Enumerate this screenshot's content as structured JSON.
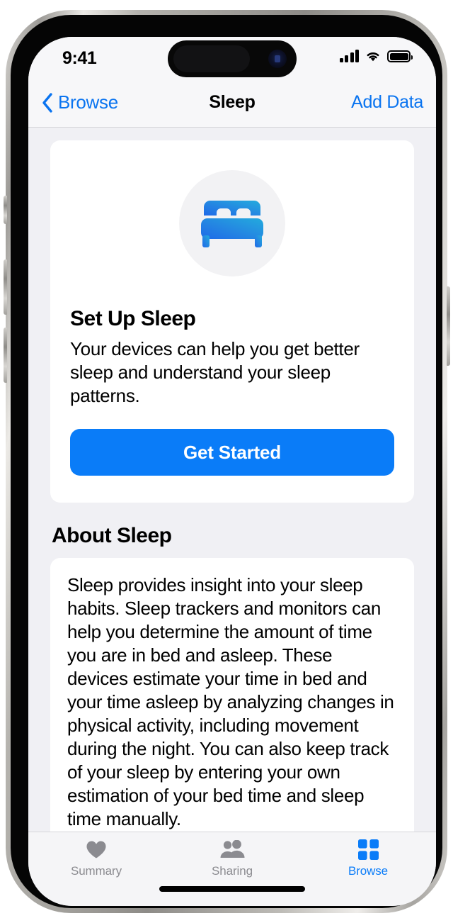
{
  "status_bar": {
    "time": "9:41",
    "cellular_icon": "cellular-signal-icon",
    "wifi_icon": "wifi-icon",
    "battery_icon": "battery-full-icon"
  },
  "nav_bar": {
    "back_icon": "chevron-left-icon",
    "back_label": "Browse",
    "title": "Sleep",
    "action_label": "Add Data"
  },
  "setup_card": {
    "icon": "bed-icon",
    "heading": "Set Up Sleep",
    "description": "Your devices can help you get better sleep and understand your sleep patterns.",
    "button_label": "Get Started"
  },
  "about_section": {
    "heading": "About Sleep",
    "body": "Sleep provides insight into your sleep habits. Sleep trackers and monitors can help you determine the amount of time you are in bed and asleep. These devices estimate your time in bed and your time asleep by analyzing changes in physical activity, including movement during the night. You can also keep track of your sleep by entering your own estimation of your bed time and sleep time manually."
  },
  "tab_bar": {
    "tabs": [
      {
        "label": "Summary",
        "icon": "heart-icon",
        "active": false
      },
      {
        "label": "Sharing",
        "icon": "people-icon",
        "active": false
      },
      {
        "label": "Browse",
        "icon": "grid-squares-icon",
        "active": true
      }
    ]
  },
  "colors": {
    "accent_blue": "#0a7cf8",
    "link_blue": "#0a74f0",
    "screen_background": "#f0f0f4",
    "card_background": "#ffffff",
    "inactive_tab": "#8b8b90",
    "icon_gradient_start": "#23abdd",
    "icon_gradient_end": "#1f6ae8"
  }
}
